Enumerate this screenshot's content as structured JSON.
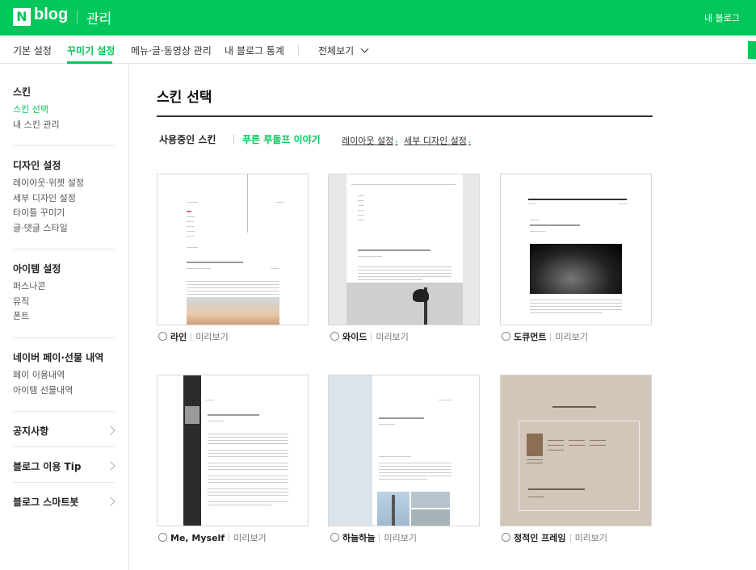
{
  "header": {
    "logo_n": "N",
    "logo_blog": "blog",
    "manage": "관리",
    "my_blog": "내 블로그"
  },
  "tabs": [
    {
      "label": "기본 설정"
    },
    {
      "label": "꾸미기 설정"
    },
    {
      "label": "메뉴·글·동영상 관리"
    },
    {
      "label": "내 블로그 통계"
    },
    {
      "label": "전체보기"
    }
  ],
  "sidebar": {
    "skin": {
      "title": "스킨",
      "items": [
        "스킨 선택",
        "내 스킨 관리"
      ]
    },
    "design": {
      "title": "디자인 설정",
      "items": [
        "레이아웃·위젯 설정",
        "세부 디자인 설정",
        "타이틀 꾸미기",
        "글·댓글 스타일"
      ]
    },
    "item": {
      "title": "아이템 설정",
      "items": [
        "퍼스나콘",
        "뮤직",
        "폰트"
      ]
    },
    "pay": {
      "title": "네이버 페이·선물 내역",
      "items": [
        "페이 이용내역",
        "아이템 선물내역"
      ]
    },
    "links": [
      "공지사항",
      "블로그 이용 Tip",
      "블로그 스마트봇"
    ]
  },
  "main": {
    "title": "스킨 선택",
    "using_label": "사용중인 스킨",
    "using_name": "푸른 루돌프 이야기",
    "layout_link": "레이아웃 설정",
    "detail_link": "세부 디자인 설정",
    "preview_label": "미리보기",
    "skins": [
      {
        "name": "라인"
      },
      {
        "name": "와이드"
      },
      {
        "name": "도큐먼트"
      },
      {
        "name": "Me, Myself"
      },
      {
        "name": "하늘하늘"
      },
      {
        "name": "정적인 프레임"
      }
    ]
  },
  "colors": {
    "brand": "#03c75a"
  }
}
